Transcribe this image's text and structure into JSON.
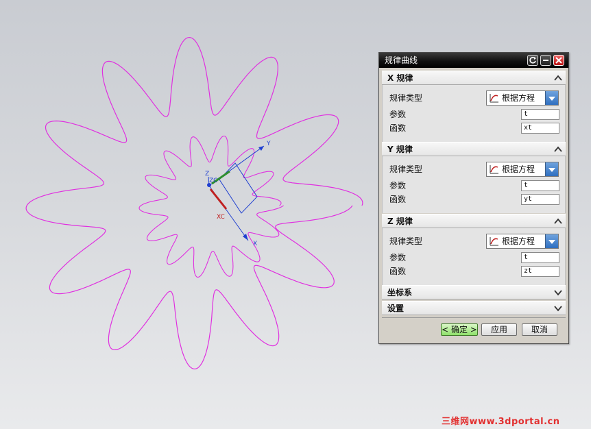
{
  "dialog": {
    "title": "规律曲线",
    "sections": [
      {
        "title": "X 规律",
        "law_type_label": "规律类型",
        "law_type_value": "根据方程",
        "param_label": "参数",
        "param_value": "t",
        "func_label": "函数",
        "func_value": "xt"
      },
      {
        "title": "Y 规律",
        "law_type_label": "规律类型",
        "law_type_value": "根据方程",
        "param_label": "参数",
        "param_value": "t",
        "func_label": "函数",
        "func_value": "yt"
      },
      {
        "title": "Z 规律",
        "law_type_label": "规律类型",
        "law_type_value": "根据方程",
        "param_label": "参数",
        "param_value": "t",
        "func_label": "函数",
        "func_value": "zt"
      }
    ],
    "collapsed": [
      {
        "title": "坐标系"
      },
      {
        "title": "设置"
      }
    ],
    "buttons": {
      "ok": "< 确定 >",
      "apply": "应用",
      "cancel": "取消"
    }
  },
  "axes": {
    "y_label": "Y",
    "x_label": "X",
    "z_label": "Z",
    "zc_label": "ZC",
    "xc_label": "XC"
  },
  "watermark": "三维网www.3dportal.cn",
  "colors": {
    "curve": "#e030e0",
    "titlebar": "#000000",
    "accent_dropdown": "#2f6fc0",
    "ok_button": "#8ee06a",
    "watermark": "#e23030"
  },
  "icons": {
    "reset": "reset-icon",
    "minimize": "minimize-icon",
    "close": "close-icon",
    "law_type": "law-curve-icon",
    "chevron_up": "chevron-up-icon",
    "chevron_down": "chevron-down-icon"
  }
}
